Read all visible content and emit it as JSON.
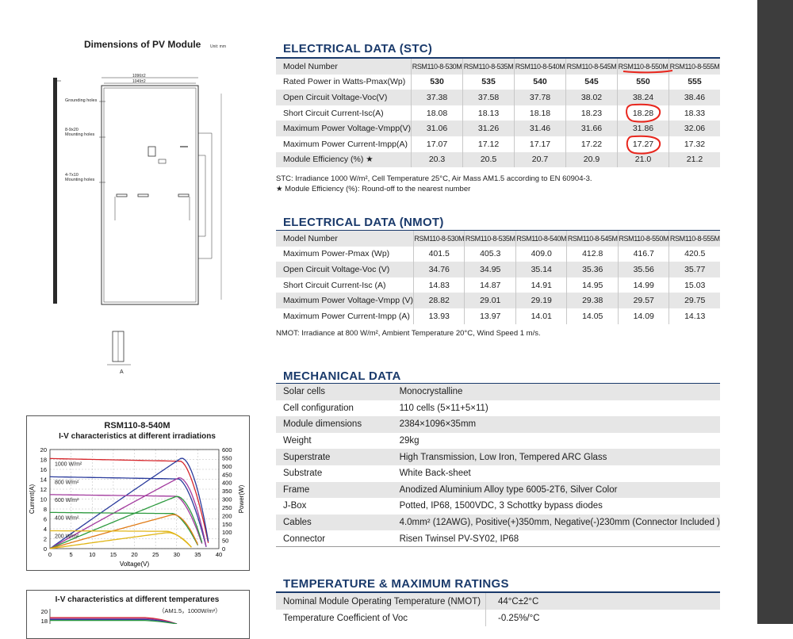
{
  "dimensions": {
    "title": "Dimensions of PV Module",
    "unit": "Unit: mm",
    "dim_outer": "1096±2",
    "dim_inner": "1049±2",
    "labels": {
      "grounding": "Grounding holes",
      "mounting1": "8-9x20\nMounting holes",
      "mounting2": "4-7x10\nMounting holes",
      "a_label": "A"
    }
  },
  "stc": {
    "title": "ELECTRICAL DATA (STC)",
    "header_label": "Model Number",
    "models": [
      "RSM110-8-530M",
      "RSM110-8-535M",
      "RSM110-8-540M",
      "RSM110-8-545M",
      "RSM110-8-550M",
      "RSM110-8-555M"
    ],
    "rows": [
      {
        "label": "Rated Power in Watts-Pmax(Wp)",
        "values": [
          "530",
          "535",
          "540",
          "545",
          "550",
          "555"
        ]
      },
      {
        "label": "Open Circuit Voltage-Voc(V)",
        "values": [
          "37.38",
          "37.58",
          "37.78",
          "38.02",
          "38.24",
          "38.46"
        ]
      },
      {
        "label": "Short Circuit Current-Isc(A)",
        "values": [
          "18.08",
          "18.13",
          "18.18",
          "18.23",
          "18.28",
          "18.33"
        ]
      },
      {
        "label": "Maximum Power Voltage-Vmpp(V)",
        "values": [
          "31.06",
          "31.26",
          "31.46",
          "31.66",
          "31.86",
          "32.06"
        ]
      },
      {
        "label": "Maximum Power Current-Impp(A)",
        "values": [
          "17.07",
          "17.12",
          "17.17",
          "17.22",
          "17.27",
          "17.32"
        ]
      },
      {
        "label": "Module Efficiency (%) ★",
        "values": [
          "20.3",
          "20.5",
          "20.7",
          "20.9",
          "21.0",
          "21.2"
        ]
      }
    ],
    "note1": "STC: Irradiance 1000 W/m², Cell Temperature 25°C, Air Mass AM1.5 according to EN 60904-3.",
    "note2": "★ Module Efficiency (%): Round-off to the nearest number"
  },
  "nmot": {
    "title": "ELECTRICAL DATA (NMOT)",
    "header_label": "Model Number",
    "models": [
      "RSM110-8-530M",
      "RSM110-8-535M",
      "RSM110-8-540M",
      "RSM110-8-545M",
      "RSM110-8-550M",
      "RSM110-8-555M"
    ],
    "rows": [
      {
        "label": "Maximum Power-Pmax (Wp)",
        "values": [
          "401.5",
          "405.3",
          "409.0",
          "412.8",
          "416.7",
          "420.5"
        ]
      },
      {
        "label": "Open Circuit Voltage-Voc (V)",
        "values": [
          "34.76",
          "34.95",
          "35.14",
          "35.36",
          "35.56",
          "35.77"
        ]
      },
      {
        "label": "Short Circuit Current-Isc (A)",
        "values": [
          "14.83",
          "14.87",
          "14.91",
          "14.95",
          "14.99",
          "15.03"
        ]
      },
      {
        "label": "Maximum Power Voltage-Vmpp (V)",
        "values": [
          "28.82",
          "29.01",
          "29.19",
          "29.38",
          "29.57",
          "29.75"
        ]
      },
      {
        "label": "Maximum Power Current-Impp (A)",
        "values": [
          "13.93",
          "13.97",
          "14.01",
          "14.05",
          "14.09",
          "14.13"
        ]
      }
    ],
    "note": "NMOT: Irradiance at 800 W/m², Ambient Temperature 20°C, Wind Speed 1 m/s."
  },
  "mechanical": {
    "title": "MECHANICAL DATA",
    "rows": [
      {
        "label": "Solar cells",
        "value": "Monocrystalline"
      },
      {
        "label": "Cell configuration",
        "value": "110 cells (5×11+5×11)"
      },
      {
        "label": "Module dimensions",
        "value": "2384×1096×35mm"
      },
      {
        "label": "Weight",
        "value": "29kg"
      },
      {
        "label": "Superstrate",
        "value": "High Transmission, Low Iron, Tempered ARC Glass"
      },
      {
        "label": "Substrate",
        "value": "White Back-sheet"
      },
      {
        "label": "Frame",
        "value": "Anodized Aluminium Alloy type 6005-2T6, Silver Color"
      },
      {
        "label": "J-Box",
        "value": "Potted, IP68, 1500VDC, 3 Schottky bypass diodes"
      },
      {
        "label": "Cables",
        "value": "4.0mm² (12AWG), Positive(+)350mm, Negative(-)230mm (Connector Included )"
      },
      {
        "label": "Connector",
        "value": "Risen Twinsel PV-SY02, IP68"
      }
    ]
  },
  "temperature": {
    "title": "TEMPERATURE & MAXIMUM RATINGS",
    "rows": [
      {
        "label": "Nominal Module Operating Temperature (NMOT)",
        "value": "44°C±2°C"
      },
      {
        "label": "Temperature Coefficient of Voc",
        "value": "-0.25%/°C"
      }
    ]
  },
  "chart_data": [
    {
      "type": "line",
      "model": "RSM110-8-540M",
      "title": "I-V characteristics at different irradiations",
      "xlabel": "Voltage(V)",
      "ylabel": "Current(A)",
      "y2label": "Power(W)",
      "xlim": [
        0,
        40
      ],
      "ylim": [
        0,
        20
      ],
      "y2lim": [
        0,
        600
      ],
      "x_ticks": [
        "0",
        "5",
        "10",
        "15",
        "20",
        "25",
        "30",
        "35",
        "40"
      ],
      "y_ticks": [
        "0",
        "2",
        "4",
        "6",
        "8",
        "10",
        "12",
        "14",
        "16",
        "18",
        "20"
      ],
      "y2_ticks": [
        "0",
        "50",
        "100",
        "150",
        "200",
        "250",
        "300",
        "350",
        "400",
        "450",
        "500",
        "550",
        "600"
      ],
      "series": [
        {
          "name": "1000 W/m²",
          "isc": 18.18,
          "voc": 37.78,
          "color": "#d6262b",
          "pcolor": "#2a3b9c"
        },
        {
          "name": "800 W/m²",
          "isc": 14.5,
          "voc": 37.1,
          "color": "#2a3b9c",
          "pcolor": "#a23a9e"
        },
        {
          "name": "600 W/m²",
          "isc": 10.9,
          "voc": 36.4,
          "color": "#a23a9e",
          "pcolor": "#2d9a3f"
        },
        {
          "name": "400 W/m²",
          "isc": 7.3,
          "voc": 35.4,
          "color": "#2d9a3f",
          "pcolor": "#e07b16"
        },
        {
          "name": "200 W/m²",
          "isc": 3.6,
          "voc": 33.8,
          "color": "#e0b516",
          "pcolor": "#e0b516"
        }
      ]
    },
    {
      "type": "line",
      "title": "I-V characteristics at different temperatures",
      "subtitle": "（AM1.5，1000W/m²）",
      "y_ticks": [
        "18",
        "20"
      ]
    }
  ]
}
